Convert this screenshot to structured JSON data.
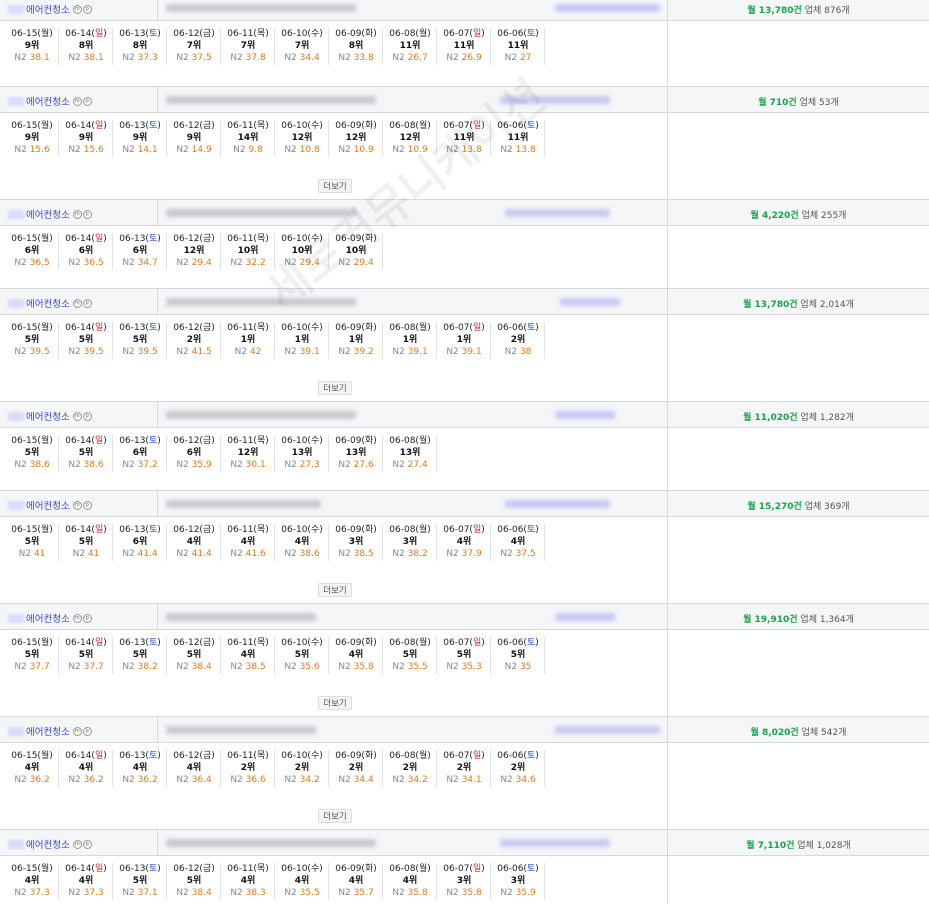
{
  "watermark": "세로커뮤니케이션",
  "more_label": "더보기",
  "rows": [
    {
      "keyword": "에어컨청소",
      "devices": [
        "m",
        "p"
      ],
      "volume_month": "월 13,780건",
      "volume_companies": "업체 876개",
      "has_more": false,
      "days": [
        {
          "date": "06-15",
          "wd": "월",
          "rank": "9위",
          "n2": "38.1"
        },
        {
          "date": "06-14",
          "wd": "일",
          "rank": "8위",
          "n2": "38.1"
        },
        {
          "date": "06-13",
          "wd": "토",
          "rank": "8위",
          "n2": "37.3"
        },
        {
          "date": "06-12",
          "wd": "금",
          "rank": "7위",
          "n2": "37.5"
        },
        {
          "date": "06-11",
          "wd": "목",
          "rank": "7위",
          "n2": "37.8"
        },
        {
          "date": "06-10",
          "wd": "수",
          "rank": "7위",
          "n2": "34.4"
        },
        {
          "date": "06-09",
          "wd": "화",
          "rank": "8위",
          "n2": "33.8"
        },
        {
          "date": "06-08",
          "wd": "월",
          "rank": "11위",
          "n2": "26.7"
        },
        {
          "date": "06-07",
          "wd": "일",
          "rank": "11위",
          "n2": "26.9"
        },
        {
          "date": "06-06",
          "wd": "토",
          "rank": "11위",
          "n2": "27"
        }
      ]
    },
    {
      "keyword": "에어컨청소",
      "devices": [
        "m",
        "p"
      ],
      "volume_month": "월 710건",
      "volume_companies": "업체 53개",
      "has_more": true,
      "days": [
        {
          "date": "06-15",
          "wd": "월",
          "rank": "9위",
          "n2": "15.6"
        },
        {
          "date": "06-14",
          "wd": "일",
          "rank": "9위",
          "n2": "15.6"
        },
        {
          "date": "06-13",
          "wd": "토",
          "rank": "9위",
          "n2": "14.1"
        },
        {
          "date": "06-12",
          "wd": "금",
          "rank": "9위",
          "n2": "14.9"
        },
        {
          "date": "06-11",
          "wd": "목",
          "rank": "14위",
          "n2": "9.8"
        },
        {
          "date": "06-10",
          "wd": "수",
          "rank": "12위",
          "n2": "10.8"
        },
        {
          "date": "06-09",
          "wd": "화",
          "rank": "12위",
          "n2": "10.9"
        },
        {
          "date": "06-08",
          "wd": "월",
          "rank": "12위",
          "n2": "10.9"
        },
        {
          "date": "06-07",
          "wd": "일",
          "rank": "11위",
          "n2": "13.8"
        },
        {
          "date": "06-06",
          "wd": "토",
          "rank": "11위",
          "n2": "13.8"
        }
      ]
    },
    {
      "keyword": "에어컨청소",
      "devices": [
        "m",
        "p"
      ],
      "volume_month": "월 4,220건",
      "volume_companies": "업체 255개",
      "has_more": false,
      "days": [
        {
          "date": "06-15",
          "wd": "월",
          "rank": "6위",
          "n2": "36.5"
        },
        {
          "date": "06-14",
          "wd": "일",
          "rank": "6위",
          "n2": "36.5"
        },
        {
          "date": "06-13",
          "wd": "토",
          "rank": "6위",
          "n2": "34.7"
        },
        {
          "date": "06-12",
          "wd": "금",
          "rank": "12위",
          "n2": "29.4"
        },
        {
          "date": "06-11",
          "wd": "목",
          "rank": "10위",
          "n2": "32.2"
        },
        {
          "date": "06-10",
          "wd": "수",
          "rank": "10위",
          "n2": "29.4"
        },
        {
          "date": "06-09",
          "wd": "화",
          "rank": "10위",
          "n2": "29.4"
        }
      ]
    },
    {
      "keyword": "에어컨청소",
      "devices": [
        "m",
        "p"
      ],
      "volume_month": "월 13,780건",
      "volume_companies": "업체 2,014개",
      "has_more": true,
      "days": [
        {
          "date": "06-15",
          "wd": "월",
          "rank": "5위",
          "n2": "39.5"
        },
        {
          "date": "06-14",
          "wd": "일",
          "rank": "5위",
          "n2": "39.5"
        },
        {
          "date": "06-13",
          "wd": "토",
          "rank": "5위",
          "n2": "39.5"
        },
        {
          "date": "06-12",
          "wd": "금",
          "rank": "2위",
          "n2": "41.5"
        },
        {
          "date": "06-11",
          "wd": "목",
          "rank": "1위",
          "n2": "42"
        },
        {
          "date": "06-10",
          "wd": "수",
          "rank": "1위",
          "n2": "39.1"
        },
        {
          "date": "06-09",
          "wd": "화",
          "rank": "1위",
          "n2": "39.2"
        },
        {
          "date": "06-08",
          "wd": "월",
          "rank": "1위",
          "n2": "39.1"
        },
        {
          "date": "06-07",
          "wd": "일",
          "rank": "1위",
          "n2": "39.1"
        },
        {
          "date": "06-06",
          "wd": "토",
          "rank": "2위",
          "n2": "38"
        }
      ]
    },
    {
      "keyword": "에어컨청소",
      "devices": [
        "m",
        "p"
      ],
      "volume_month": "월 11,020건",
      "volume_companies": "업체 1,282개",
      "has_more": false,
      "days": [
        {
          "date": "06-15",
          "wd": "월",
          "rank": "5위",
          "n2": "38.6"
        },
        {
          "date": "06-14",
          "wd": "일",
          "rank": "5위",
          "n2": "38.6"
        },
        {
          "date": "06-13",
          "wd": "토",
          "rank": "6위",
          "n2": "37.2"
        },
        {
          "date": "06-12",
          "wd": "금",
          "rank": "6위",
          "n2": "35.9"
        },
        {
          "date": "06-11",
          "wd": "목",
          "rank": "12위",
          "n2": "30.1"
        },
        {
          "date": "06-10",
          "wd": "수",
          "rank": "13위",
          "n2": "27.3"
        },
        {
          "date": "06-09",
          "wd": "화",
          "rank": "13위",
          "n2": "27.6"
        },
        {
          "date": "06-08",
          "wd": "월",
          "rank": "13위",
          "n2": "27.4"
        }
      ]
    },
    {
      "keyword": "에어컨청소",
      "devices": [
        "m",
        "p"
      ],
      "volume_month": "월 15,270건",
      "volume_companies": "업체 369개",
      "has_more": true,
      "days": [
        {
          "date": "06-15",
          "wd": "월",
          "rank": "5위",
          "n2": "41"
        },
        {
          "date": "06-14",
          "wd": "일",
          "rank": "5위",
          "n2": "41"
        },
        {
          "date": "06-13",
          "wd": "토",
          "rank": "6위",
          "n2": "41.4"
        },
        {
          "date": "06-12",
          "wd": "금",
          "rank": "4위",
          "n2": "41.4"
        },
        {
          "date": "06-11",
          "wd": "목",
          "rank": "4위",
          "n2": "41.6"
        },
        {
          "date": "06-10",
          "wd": "수",
          "rank": "4위",
          "n2": "38.6"
        },
        {
          "date": "06-09",
          "wd": "화",
          "rank": "3위",
          "n2": "38.5"
        },
        {
          "date": "06-08",
          "wd": "월",
          "rank": "3위",
          "n2": "38.2"
        },
        {
          "date": "06-07",
          "wd": "일",
          "rank": "4위",
          "n2": "37.9"
        },
        {
          "date": "06-06",
          "wd": "토",
          "rank": "4위",
          "n2": "37.5"
        }
      ]
    },
    {
      "keyword": "에어컨청소",
      "devices": [
        "m",
        "p"
      ],
      "volume_month": "월 19,910건",
      "volume_companies": "업체 1,364개",
      "has_more": true,
      "days": [
        {
          "date": "06-15",
          "wd": "월",
          "rank": "5위",
          "n2": "37.7"
        },
        {
          "date": "06-14",
          "wd": "일",
          "rank": "5위",
          "n2": "37.7"
        },
        {
          "date": "06-13",
          "wd": "토",
          "rank": "5위",
          "n2": "38.2"
        },
        {
          "date": "06-12",
          "wd": "금",
          "rank": "5위",
          "n2": "38.4"
        },
        {
          "date": "06-11",
          "wd": "목",
          "rank": "4위",
          "n2": "38.5"
        },
        {
          "date": "06-10",
          "wd": "수",
          "rank": "5위",
          "n2": "35.6"
        },
        {
          "date": "06-09",
          "wd": "화",
          "rank": "4위",
          "n2": "35.8"
        },
        {
          "date": "06-08",
          "wd": "월",
          "rank": "5위",
          "n2": "35.5"
        },
        {
          "date": "06-07",
          "wd": "일",
          "rank": "5위",
          "n2": "35.3"
        },
        {
          "date": "06-06",
          "wd": "토",
          "rank": "5위",
          "n2": "35"
        }
      ]
    },
    {
      "keyword": "에어컨청소",
      "devices": [
        "m",
        "p"
      ],
      "volume_month": "월 8,020건",
      "volume_companies": "업체 542개",
      "has_more": true,
      "days": [
        {
          "date": "06-15",
          "wd": "월",
          "rank": "4위",
          "n2": "36.2"
        },
        {
          "date": "06-14",
          "wd": "일",
          "rank": "4위",
          "n2": "36.2"
        },
        {
          "date": "06-13",
          "wd": "토",
          "rank": "4위",
          "n2": "36.2"
        },
        {
          "date": "06-12",
          "wd": "금",
          "rank": "4위",
          "n2": "36.4"
        },
        {
          "date": "06-11",
          "wd": "목",
          "rank": "2위",
          "n2": "36.6"
        },
        {
          "date": "06-10",
          "wd": "수",
          "rank": "2위",
          "n2": "34.2"
        },
        {
          "date": "06-09",
          "wd": "화",
          "rank": "2위",
          "n2": "34.4"
        },
        {
          "date": "06-08",
          "wd": "월",
          "rank": "2위",
          "n2": "34.2"
        },
        {
          "date": "06-07",
          "wd": "일",
          "rank": "2위",
          "n2": "34.1"
        },
        {
          "date": "06-06",
          "wd": "토",
          "rank": "2위",
          "n2": "34.6"
        }
      ]
    },
    {
      "keyword": "에어컨청소",
      "devices": [
        "m",
        "p"
      ],
      "volume_month": "월 7,110건",
      "volume_companies": "업체 1,028개",
      "has_more": false,
      "days": [
        {
          "date": "06-15",
          "wd": "월",
          "rank": "4위",
          "n2": "37.3"
        },
        {
          "date": "06-14",
          "wd": "일",
          "rank": "4위",
          "n2": "37.3"
        },
        {
          "date": "06-13",
          "wd": "토",
          "rank": "5위",
          "n2": "37.1"
        },
        {
          "date": "06-12",
          "wd": "금",
          "rank": "5위",
          "n2": "38.4"
        },
        {
          "date": "06-11",
          "wd": "목",
          "rank": "4위",
          "n2": "38.3"
        },
        {
          "date": "06-10",
          "wd": "수",
          "rank": "4위",
          "n2": "35.5"
        },
        {
          "date": "06-09",
          "wd": "화",
          "rank": "4위",
          "n2": "35.7"
        },
        {
          "date": "06-08",
          "wd": "월",
          "rank": "4위",
          "n2": "35.8"
        },
        {
          "date": "06-07",
          "wd": "일",
          "rank": "3위",
          "n2": "35.8"
        },
        {
          "date": "06-06",
          "wd": "토",
          "rank": "3위",
          "n2": "35.9"
        }
      ]
    }
  ]
}
